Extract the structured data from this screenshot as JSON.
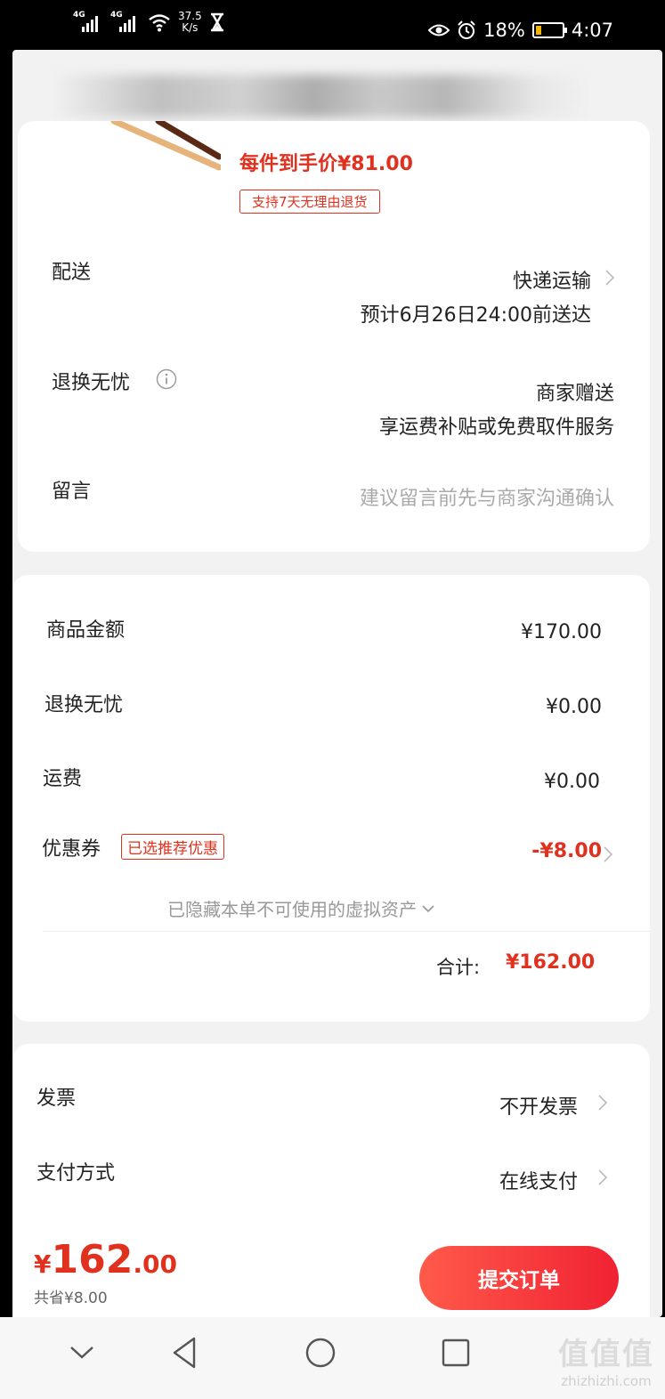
{
  "status_bar": {
    "signal1_tag": "4G",
    "signal2_tag": "4G",
    "speed_value": "37.5",
    "speed_unit": "K/s",
    "battery": "18%",
    "time": "4:07"
  },
  "product": {
    "unit_price": "每件到手价¥81.00",
    "return_badge": "支持7天无理由退货"
  },
  "delivery": {
    "label": "配送",
    "method": "快递运输",
    "eta": "预计6月26日24:00前送达"
  },
  "worry_free": {
    "label": "退换无忧",
    "value": "商家赠送",
    "desc": "享运费补贴或免费取件服务"
  },
  "message": {
    "label": "留言",
    "placeholder": "建议留言前先与商家沟通确认"
  },
  "prices": {
    "goods_label": "商品金额",
    "goods_value": "¥170.00",
    "worry_free_label": "退换无忧",
    "worry_free_value": "¥0.00",
    "shipping_label": "运费",
    "shipping_value": "¥0.00",
    "coupon_label": "优惠券",
    "coupon_tag": "已选推荐优惠",
    "coupon_value": "-¥8.00",
    "hidden_assets": "已隐藏本单不可使用的虚拟资产",
    "total_label": "合计:",
    "total_value": "¥162.00"
  },
  "invoice": {
    "label": "发票",
    "value": "不开发票"
  },
  "payment": {
    "label": "支付方式",
    "value": "在线支付"
  },
  "bottom": {
    "currency": "¥",
    "amount_int": "162",
    "amount_dec": ".00",
    "saved": "共省¥8.00",
    "submit": "提交订单"
  },
  "watermark": {
    "big": "值值值",
    "small": "zhizhizhi.com"
  },
  "colors": {
    "accent": "#e0301e",
    "button": "#f02233"
  }
}
